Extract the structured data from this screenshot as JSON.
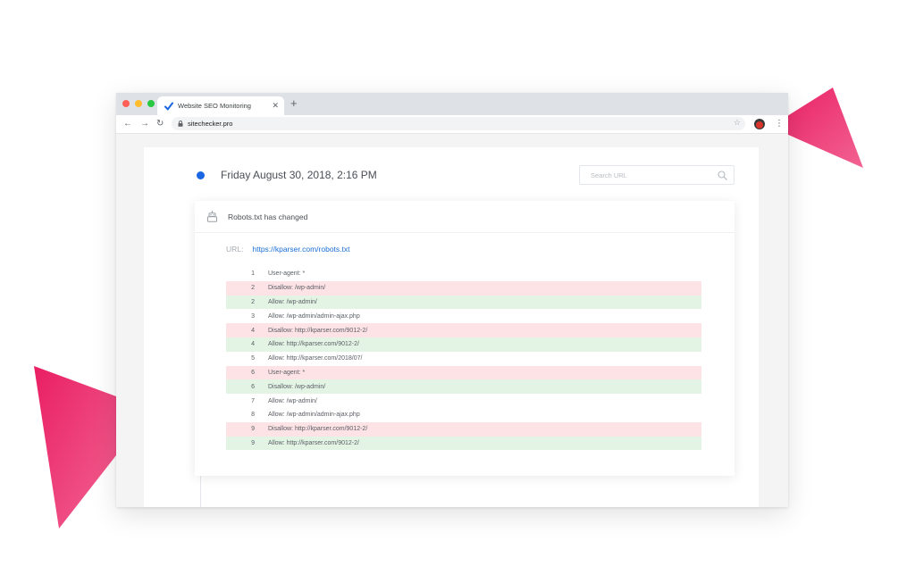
{
  "colors": {
    "accent_pink": "#ec2566",
    "timeline_blue": "#1a66e3",
    "timeline_red": "#e8485a",
    "removed_bg": "#fde3e6",
    "added_bg": "#e3f4e5",
    "link_blue": "#1a6ed8"
  },
  "browser": {
    "tab_title": "Website SEO Monitoring",
    "tab_close": "✕",
    "new_tab": "+",
    "back": "←",
    "forward": "→",
    "reload": "↻",
    "url": "sitechecker.pro",
    "bookmark_star": "☆",
    "menu": "⋮"
  },
  "page": {
    "date_heading": "Friday August 30, 2018, 2:16 PM",
    "search_placeholder": "Search URL",
    "card": {
      "title": "Robots.txt has changed",
      "url_label": "URL:",
      "url_value": "https://kparser.com/robots.txt"
    },
    "diff_rows": [
      {
        "num": "1",
        "text": "User-agent: *",
        "status": "unchanged"
      },
      {
        "num": "2",
        "text": "Disallow: /wp-admin/",
        "status": "removed"
      },
      {
        "num": "2",
        "text": "Allow: /wp-admin/",
        "status": "added"
      },
      {
        "num": "3",
        "text": "Allow: /wp-admin/admin-ajax.php",
        "status": "unchanged"
      },
      {
        "num": "4",
        "text": "Disallow: http://kparser.com/9012-2/",
        "status": "removed"
      },
      {
        "num": "4",
        "text": "Allow: http://kparser.com/9012-2/",
        "status": "added"
      },
      {
        "num": "5",
        "text": "Allow: http://kparser.com/2018/07/",
        "status": "unchanged"
      },
      {
        "num": "6",
        "text": "User-agent: *",
        "status": "removed"
      },
      {
        "num": "6",
        "text": "Disallow: /wp-admin/",
        "status": "added"
      },
      {
        "num": "7",
        "text": "Allow: /wp-admin/",
        "status": "unchanged"
      },
      {
        "num": "8",
        "text": "Allow: /wp-admin/admin-ajax.php",
        "status": "unchanged"
      },
      {
        "num": "9",
        "text": "Disallow: http://kparser.com/9012-2/",
        "status": "removed"
      },
      {
        "num": "9",
        "text": "Allow: http://kparser.com/9012-2/",
        "status": "added"
      }
    ]
  }
}
